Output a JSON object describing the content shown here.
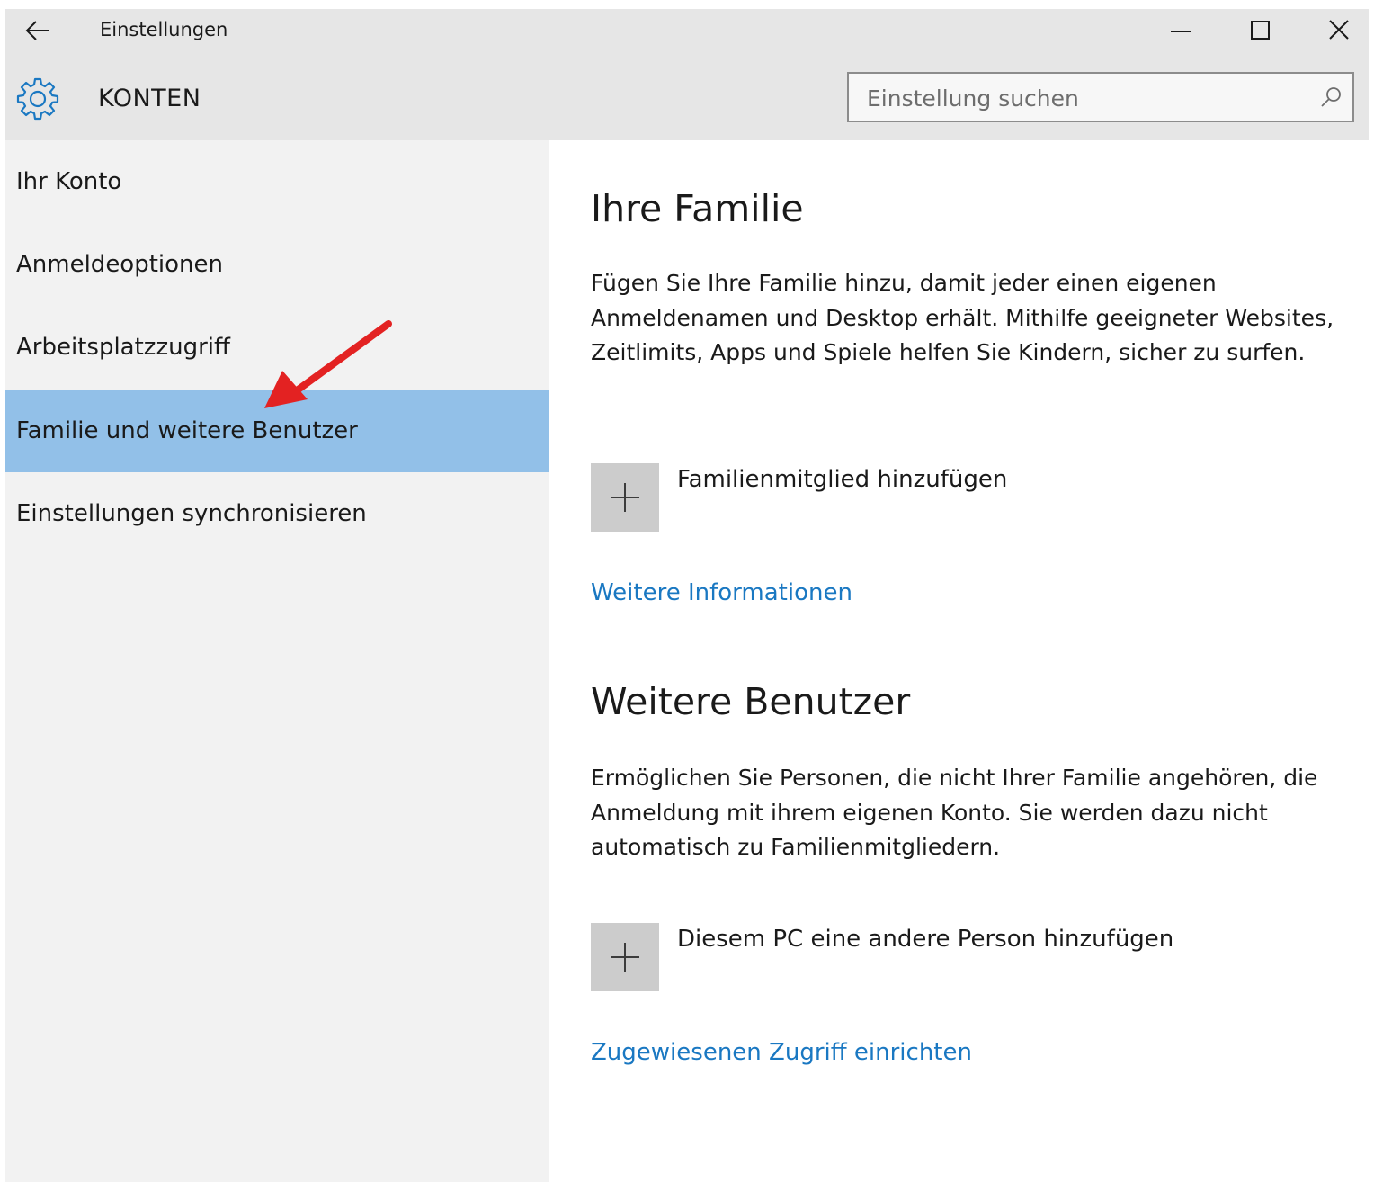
{
  "window": {
    "title": "Einstellungen"
  },
  "header": {
    "section_title": "KONTEN",
    "search_placeholder": "Einstellung suchen"
  },
  "sidebar": {
    "items": [
      {
        "label": "Ihr Konto",
        "selected": false
      },
      {
        "label": "Anmeldeoptionen",
        "selected": false
      },
      {
        "label": "Arbeitsplatzzugriff",
        "selected": false
      },
      {
        "label": "Familie und weitere Benutzer",
        "selected": true
      },
      {
        "label": "Einstellungen synchronisieren",
        "selected": false
      }
    ]
  },
  "main": {
    "family": {
      "heading": "Ihre Familie",
      "description": "Fügen Sie Ihre Familie hinzu, damit jeder einen eigenen Anmeldenamen und Desktop erhält. Mithilfe geeigneter Websites, Zeitlimits, Apps und Spiele helfen Sie Kindern, sicher zu surfen.",
      "add_label": "Familienmitglied hinzufügen",
      "link": "Weitere Informationen"
    },
    "others": {
      "heading": "Weitere Benutzer",
      "description": "Ermöglichen Sie Personen, die nicht Ihrer Familie angehören, die Anmeldung mit ihrem eigenen Konto. Sie werden dazu nicht automatisch zu Familienmitgliedern.",
      "add_label": "Diesem PC eine andere Person hinzufügen",
      "link": "Zugewiesenen Zugriff einrichten"
    }
  },
  "icons": {
    "back": "back-arrow-icon",
    "minimize": "minimize-icon",
    "maximize": "maximize-icon",
    "close": "close-icon",
    "settings": "gear-icon",
    "search": "search-icon",
    "add": "plus-icon"
  },
  "colors": {
    "accent": "#1a78c2",
    "selected_nav": "#92c0e8",
    "annotation_arrow": "#e32222"
  }
}
